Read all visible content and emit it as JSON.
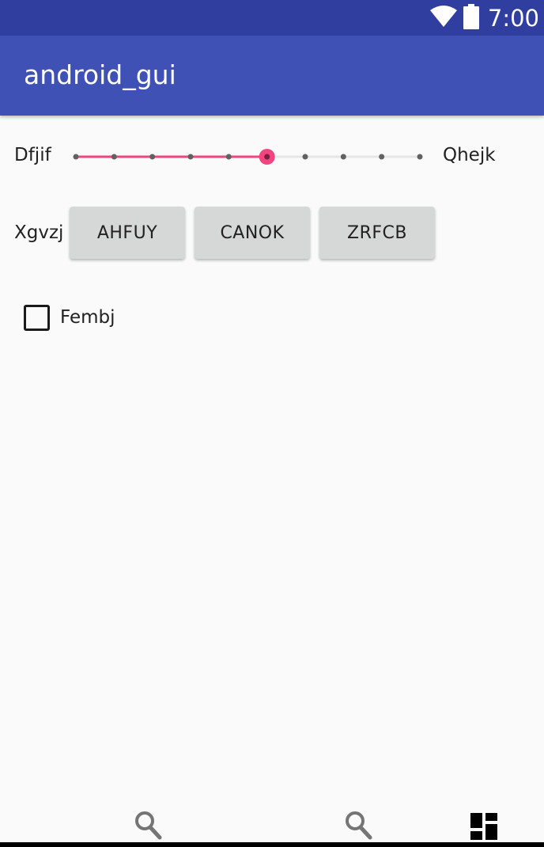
{
  "status_bar": {
    "time": "7:00",
    "icons": [
      "wifi-icon",
      "battery-icon"
    ]
  },
  "app_bar": {
    "title": "android_gui"
  },
  "seekbar_row": {
    "left_label": "Dfjif",
    "right_label": "Qhejk",
    "steps": 10,
    "value_step": 5,
    "accent_color": "#f0457e"
  },
  "button_row": {
    "label": "Xgvzj",
    "buttons": [
      "AHFUY",
      "CANOK",
      "ZRFCB"
    ]
  },
  "checkbox": {
    "label": "Fembj",
    "checked": false
  },
  "bottom_nav": {
    "icons": [
      "search-icon",
      "search-icon",
      "dashboard-icon"
    ]
  },
  "colors": {
    "status_bar": "#303f9f",
    "app_bar": "#3f51b5",
    "background": "#fafafa"
  }
}
